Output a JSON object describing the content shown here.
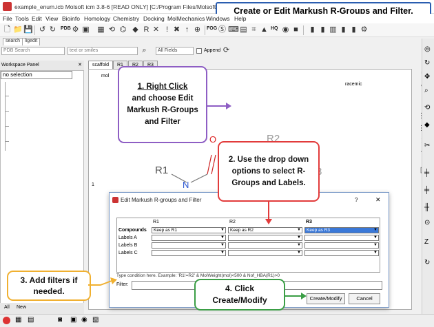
{
  "window": {
    "title": "example_enum.icb Molsoft icm 3.8-6 [READ ONLY]  [C:/Program Files/Molsoft LLC/ICM-..."
  },
  "banner": "Create or Edit Markush R-Groups and Filter.",
  "menu": [
    "File",
    "Tools",
    "Edit",
    "View",
    "Bioinfo",
    "Homology",
    "Chemistry",
    "Docking",
    "MolMechanics",
    "Windows",
    "Help"
  ],
  "toolbar": {
    "labels": [
      "PDB",
      "FOG",
      "HQ"
    ]
  },
  "subtabs": [
    "search",
    "ligedit"
  ],
  "search": {
    "db": "PDB Search",
    "query_placeholder": "text or smiles",
    "field": "All Fields",
    "append": "Append"
  },
  "workspace": {
    "title": "Workspace Panel",
    "selection": "no selection",
    "bottom_tab_all": "All",
    "bottom_tab_new": "New"
  },
  "main_tabs": [
    "scaffold",
    "R1",
    "R2",
    "R3"
  ],
  "mol": {
    "label": "mol",
    "racemic": "racemic",
    "row_index": "1",
    "atom_o": "O",
    "atom_n": "N",
    "r1": "R1",
    "r2": "R2",
    "r3": "3"
  },
  "dialog": {
    "title": "Edit Markush R-groups and Filter",
    "help": "?",
    "close": "✕",
    "columns": [
      "R1",
      "R2",
      "R3"
    ],
    "rows": [
      {
        "label": "Compounds",
        "values": [
          "Keep as R1",
          "Keep as R2",
          "Keep as R3"
        ]
      },
      {
        "label": "Labels A",
        "values": [
          "",
          "",
          ""
        ]
      },
      {
        "label": "Labels B",
        "values": [
          "",
          "",
          ""
        ]
      },
      {
        "label": "Labels C",
        "values": [
          "",
          "",
          ""
        ]
      }
    ],
    "hint": "Type condition here. Example: 'R1!=R2' & MolWeight(mol)<500 & Nof_HBA(R1)>0",
    "filter_label": "Filter:",
    "filter_value": "",
    "create_button": "Create/Modify",
    "cancel_button": "Cancel"
  },
  "callouts": {
    "step1_underlined": "1. Right Click",
    "step1_rest": "and choose Edit Markush R-Groups and Filter",
    "step2": "2. Use the drop down options to select R-Groups and Labels.",
    "step3": "3. Add filters if needed.",
    "step4": "4. Click Create/Modify"
  },
  "colors": {
    "step1_border": "#8e5ec4",
    "step2_border": "#e23b3b",
    "step3_border": "#f0b030",
    "step4_border": "#3a9e45",
    "banner_border": "#2a5db0",
    "selected_row": "#3a78d8"
  }
}
